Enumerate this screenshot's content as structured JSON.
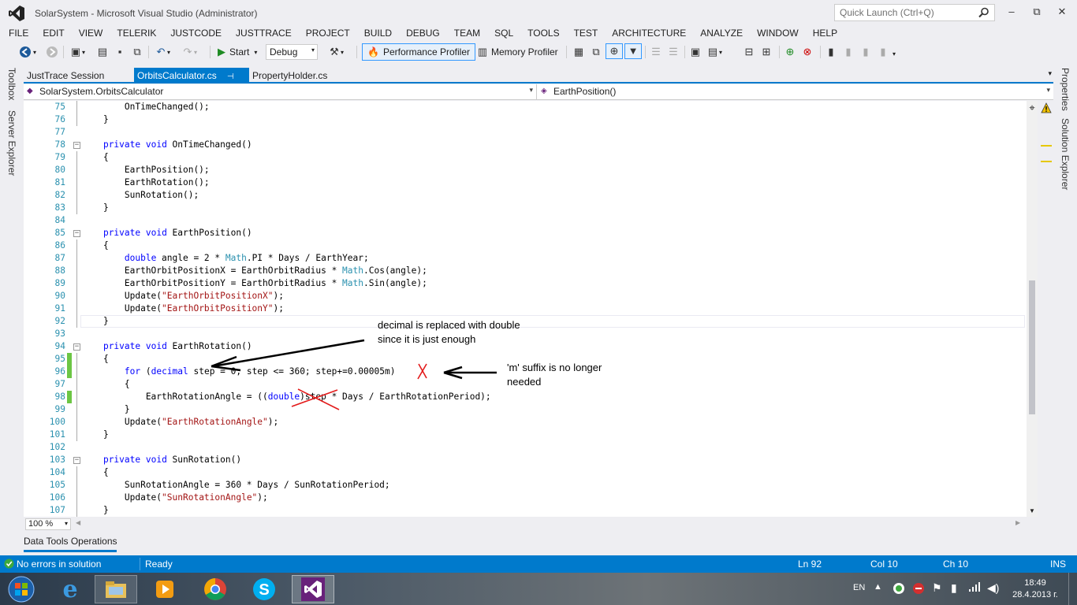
{
  "window": {
    "title": "SolarSystem - Microsoft Visual Studio (Administrator)",
    "quick_launch_placeholder": "Quick Launch (Ctrl+Q)"
  },
  "menu": [
    "FILE",
    "EDIT",
    "VIEW",
    "TELERIK",
    "JUSTCODE",
    "JUSTTRACE",
    "PROJECT",
    "BUILD",
    "DEBUG",
    "TEAM",
    "SQL",
    "TOOLS",
    "TEST",
    "ARCHITECTURE",
    "ANALYZE",
    "WINDOW",
    "HELP"
  ],
  "toolbar": {
    "start_label": "Start",
    "config_value": "Debug",
    "performance_profiler_label": "Performance Profiler",
    "memory_profiler_label": "Memory Profiler"
  },
  "side_left": {
    "toolbox": "Toolbox",
    "server_explorer": "Server Explorer"
  },
  "side_right": {
    "properties": "Properties",
    "solution_explorer": "Solution Explorer"
  },
  "doc_tabs": [
    {
      "label": "JustTrace Session"
    },
    {
      "label": "OrbitsCalculator.cs"
    },
    {
      "label": "PropertyHolder.cs"
    }
  ],
  "navbar": {
    "type": "SolarSystem.OrbitsCalculator",
    "member": "EarthPosition()"
  },
  "code_lines": [
    {
      "n": "75",
      "html": "        OnTimeChanged();"
    },
    {
      "n": "76",
      "html": "    }"
    },
    {
      "n": "77",
      "html": ""
    },
    {
      "n": "78",
      "html": "    <span class=\"kw\">private</span> <span class=\"kw\">void</span> OnTimeChanged()"
    },
    {
      "n": "79",
      "html": "    {"
    },
    {
      "n": "80",
      "html": "        EarthPosition();"
    },
    {
      "n": "81",
      "html": "        EarthRotation();"
    },
    {
      "n": "82",
      "html": "        SunRotation();"
    },
    {
      "n": "83",
      "html": "    }"
    },
    {
      "n": "84",
      "html": ""
    },
    {
      "n": "85",
      "html": "    <span class=\"kw\">private</span> <span class=\"kw\">void</span> EarthPosition()"
    },
    {
      "n": "86",
      "html": "    {"
    },
    {
      "n": "87",
      "html": "        <span class=\"kw\">double</span> angle = 2 * <span class=\"ty\">Math</span>.PI * Days / EarthYear;"
    },
    {
      "n": "88",
      "html": "        EarthOrbitPositionX = EarthOrbitRadius * <span class=\"ty\">Math</span>.Cos(angle);"
    },
    {
      "n": "89",
      "html": "        EarthOrbitPositionY = EarthOrbitRadius * <span class=\"ty\">Math</span>.Sin(angle);"
    },
    {
      "n": "90",
      "html": "        Update(<span class=\"str\">\"EarthOrbitPositionX\"</span>);"
    },
    {
      "n": "91",
      "html": "        Update(<span class=\"str\">\"EarthOrbitPositionY\"</span>);"
    },
    {
      "n": "92",
      "html": "    }"
    },
    {
      "n": "93",
      "html": ""
    },
    {
      "n": "94",
      "html": "    <span class=\"kw\">private</span> <span class=\"kw\">void</span> EarthRotation()"
    },
    {
      "n": "95",
      "html": "    {"
    },
    {
      "n": "96",
      "html": "        <span class=\"kw\">for</span> (<span class=\"kw\">decimal</span> step = 0; step &lt;= 360; step+=0.00005m)"
    },
    {
      "n": "97",
      "html": "        {"
    },
    {
      "n": "98",
      "html": "            EarthRotationAngle = ((<span class=\"kw\">double</span>)step * Days / EarthRotationPeriod);"
    },
    {
      "n": "99",
      "html": "        }"
    },
    {
      "n": "100",
      "html": "        Update(<span class=\"str\">\"EarthRotationAngle\"</span>);"
    },
    {
      "n": "101",
      "html": "    }"
    },
    {
      "n": "102",
      "html": ""
    },
    {
      "n": "103",
      "html": "    <span class=\"kw\">private</span> <span class=\"kw\">void</span> SunRotation()"
    },
    {
      "n": "104",
      "html": "    {"
    },
    {
      "n": "105",
      "html": "        SunRotationAngle = 360 * Days / SunRotationPeriod;"
    },
    {
      "n": "106",
      "html": "        Update(<span class=\"str\">\"SunRotationAngle\"</span>);"
    },
    {
      "n": "107",
      "html": "    }"
    }
  ],
  "annotations": {
    "note1_line1": "decimal is replaced with double",
    "note1_line2": "since it is just enough",
    "note2_line1": "'m' suffix is no longer",
    "note2_line2": "needed"
  },
  "zoom_value": "100 %",
  "bottom_tab": "Data Tools Operations",
  "status": {
    "errors": "No errors in solution",
    "state": "Ready",
    "ln": "Ln 92",
    "col": "Col 10",
    "ch": "Ch 10",
    "mode": "INS"
  },
  "taskbar": {
    "language": "EN",
    "time": "18:49",
    "date": "28.4.2013 г."
  },
  "colors": {
    "accent": "#007acc",
    "keyword": "#0000ff",
    "type": "#2b91af",
    "string": "#a31515",
    "change_bar": "#6cc644"
  }
}
